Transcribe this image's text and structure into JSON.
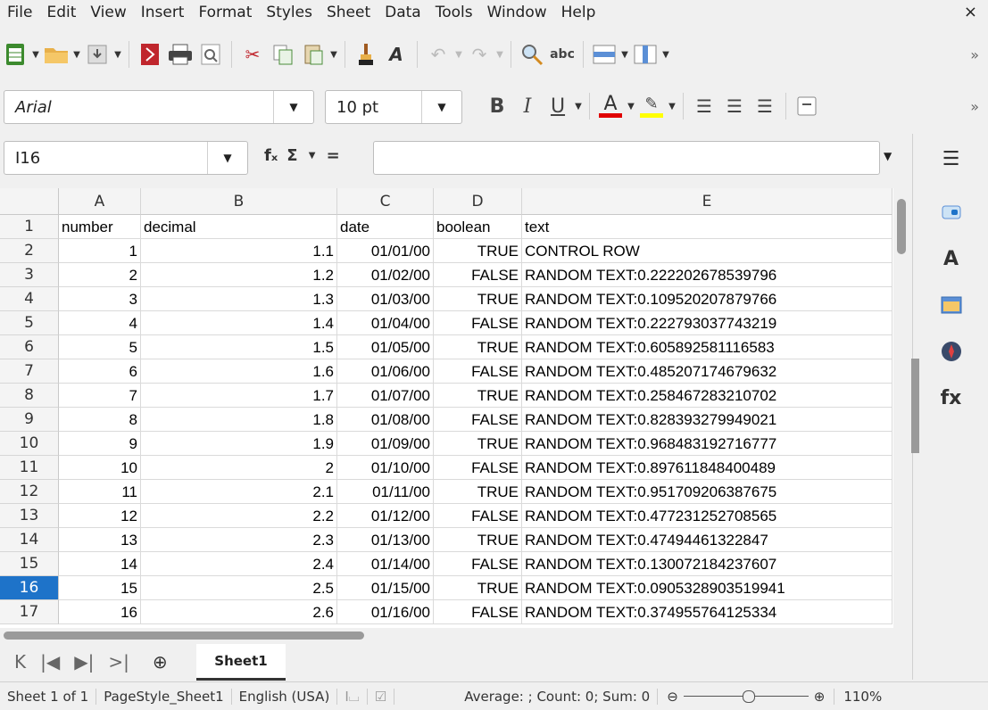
{
  "menu": [
    "File",
    "Edit",
    "View",
    "Insert",
    "Format",
    "Styles",
    "Sheet",
    "Data",
    "Tools",
    "Window",
    "Help"
  ],
  "close_glyph": "×",
  "font": {
    "name": "Arial",
    "size": "10 pt"
  },
  "cell_ref": "I16",
  "formula_buttons": {
    "fx": "fₓ",
    "sum": "Σ",
    "equals": "="
  },
  "columns": [
    "A",
    "B",
    "C",
    "D",
    "E"
  ],
  "rows": [
    {
      "n": "1",
      "a": "number",
      "b": "decimal",
      "c": "date",
      "d": "boolean",
      "e": "text",
      "header": true
    },
    {
      "n": "2",
      "a": "1",
      "b": "1.1",
      "c": "01/01/00",
      "d": "TRUE",
      "e": "CONTROL ROW"
    },
    {
      "n": "3",
      "a": "2",
      "b": "1.2",
      "c": "01/02/00",
      "d": "FALSE",
      "e": "RANDOM TEXT:0.222202678539796"
    },
    {
      "n": "4",
      "a": "3",
      "b": "1.3",
      "c": "01/03/00",
      "d": "TRUE",
      "e": "RANDOM TEXT:0.109520207879766"
    },
    {
      "n": "5",
      "a": "4",
      "b": "1.4",
      "c": "01/04/00",
      "d": "FALSE",
      "e": "RANDOM TEXT:0.222793037743219"
    },
    {
      "n": "6",
      "a": "5",
      "b": "1.5",
      "c": "01/05/00",
      "d": "TRUE",
      "e": "RANDOM TEXT:0.605892581116583"
    },
    {
      "n": "7",
      "a": "6",
      "b": "1.6",
      "c": "01/06/00",
      "d": "FALSE",
      "e": "RANDOM TEXT:0.485207174679632"
    },
    {
      "n": "8",
      "a": "7",
      "b": "1.7",
      "c": "01/07/00",
      "d": "TRUE",
      "e": "RANDOM TEXT:0.258467283210702"
    },
    {
      "n": "9",
      "a": "8",
      "b": "1.8",
      "c": "01/08/00",
      "d": "FALSE",
      "e": "RANDOM TEXT:0.828393279949021"
    },
    {
      "n": "10",
      "a": "9",
      "b": "1.9",
      "c": "01/09/00",
      "d": "TRUE",
      "e": "RANDOM TEXT:0.968483192716777"
    },
    {
      "n": "11",
      "a": "10",
      "b": "2",
      "c": "01/10/00",
      "d": "FALSE",
      "e": "RANDOM TEXT:0.897611848400489"
    },
    {
      "n": "12",
      "a": "11",
      "b": "2.1",
      "c": "01/11/00",
      "d": "TRUE",
      "e": "RANDOM TEXT:0.951709206387675"
    },
    {
      "n": "13",
      "a": "12",
      "b": "2.2",
      "c": "01/12/00",
      "d": "FALSE",
      "e": "RANDOM TEXT:0.477231252708565"
    },
    {
      "n": "14",
      "a": "13",
      "b": "2.3",
      "c": "01/13/00",
      "d": "TRUE",
      "e": "RANDOM TEXT:0.47494461322847"
    },
    {
      "n": "15",
      "a": "14",
      "b": "2.4",
      "c": "01/14/00",
      "d": "FALSE",
      "e": "RANDOM TEXT:0.130072184237607"
    },
    {
      "n": "16",
      "a": "15",
      "b": "2.5",
      "c": "01/15/00",
      "d": "TRUE",
      "e": "RANDOM TEXT:0.0905328903519941",
      "selected": true
    },
    {
      "n": "17",
      "a": "16",
      "b": "2.6",
      "c": "01/16/00",
      "d": "FALSE",
      "e": "RANDOM TEXT:0.374955764125334"
    }
  ],
  "sheet_tab": "Sheet1",
  "status": {
    "sheet": "Sheet 1 of 1",
    "page_style": "PageStyle_Sheet1",
    "language": "English (USA)",
    "summary": "Average: ; Count: 0; Sum: 0",
    "zoom": "110%"
  },
  "colors": {
    "selected_row": "#1e73c9"
  }
}
